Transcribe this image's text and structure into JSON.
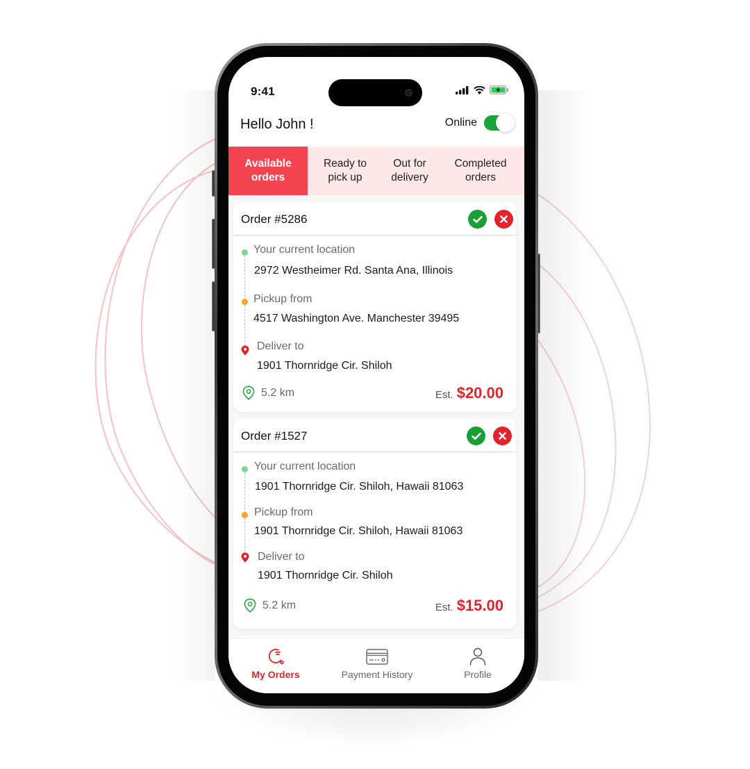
{
  "status_bar": {
    "time": "9:41",
    "icons": [
      "signal-icon",
      "wifi-icon",
      "battery-charging-icon"
    ]
  },
  "header": {
    "greeting": "Hello John !",
    "online_label": "Online",
    "online_enabled": true
  },
  "tabs": [
    {
      "label_line1": "Available",
      "label_line2": "orders",
      "active": true
    },
    {
      "label_line1": "Ready to",
      "label_line2": "pick up",
      "active": false
    },
    {
      "label_line1": "Out for",
      "label_line2": "delivery",
      "active": false
    },
    {
      "label_line1": "Completed",
      "label_line2": "orders",
      "active": false
    }
  ],
  "orders": [
    {
      "title": "Order #5286",
      "current_label": "Your  current location",
      "current_address": "2972 Westheimer Rd. Santa Ana, Illinois",
      "pickup_label": "Pickup from",
      "pickup_address": "4517 Washington Ave. Manchester 39495",
      "deliver_label": "Deliver to",
      "deliver_address": "1901 Thornridge Cir. Shiloh",
      "distance": "5.2 km",
      "est_label": "Est.",
      "price": "$20.00"
    },
    {
      "title": "Order #1527",
      "current_label": "Your  current location",
      "current_address": "1901 Thornridge Cir. Shiloh, Hawaii 81063",
      "pickup_label": "Pickup from",
      "pickup_address": "1901 Thornridge Cir. Shiloh, Hawaii 81063",
      "deliver_label": "Deliver to",
      "deliver_address": "1901 Thornridge Cir. Shiloh",
      "distance": "5.2 km",
      "est_label": "Est.",
      "price": "$15.00"
    }
  ],
  "bottom_nav": [
    {
      "label": "My Orders",
      "icon": "orders-icon",
      "active": true
    },
    {
      "label": "Payment History",
      "icon": "credit-card-icon",
      "active": false
    },
    {
      "label": "Profile",
      "icon": "user-icon",
      "active": false
    }
  ],
  "colors": {
    "accent": "#f44452",
    "tab_bg": "#fde8e9",
    "accept": "#1a9e36",
    "reject": "#e3232b",
    "price": "#e3232b",
    "toggle_on": "#1aa53a",
    "dot_current": "#7ad88f",
    "dot_pickup": "#f5a623",
    "pin_deliver": "#e3232b"
  }
}
